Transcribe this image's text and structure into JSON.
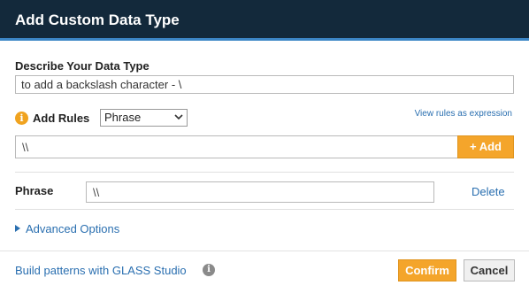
{
  "dialog": {
    "title": "Add Custom Data Type"
  },
  "describe": {
    "label": "Describe Your Data Type",
    "value": "to add a backslash character - \\"
  },
  "rules": {
    "label": "Add Rules",
    "selected_type": "Phrase",
    "view_link": "View rules as expression",
    "expression_value": "\\\\",
    "add_label": "+ Add",
    "info_icon": "i"
  },
  "rule_row": {
    "type": "Phrase",
    "value": "\\\\",
    "delete_label": "Delete"
  },
  "advanced": {
    "label": "Advanced Options"
  },
  "footer": {
    "glass_link": "Build patterns with GLASS Studio",
    "help_icon": "i",
    "confirm_label": "Confirm",
    "cancel_label": "Cancel"
  },
  "colors": {
    "header_bg": "#13293b",
    "header_accent": "#3c86c6",
    "primary_button": "#f4a52b",
    "link": "#2a6fb0",
    "info_icon": "#f0a31f"
  },
  "icons": {
    "info": "info-icon",
    "select_chevron": "chevron-down-icon",
    "advanced_toggle": "triangle-right-icon",
    "help": "help-icon"
  }
}
